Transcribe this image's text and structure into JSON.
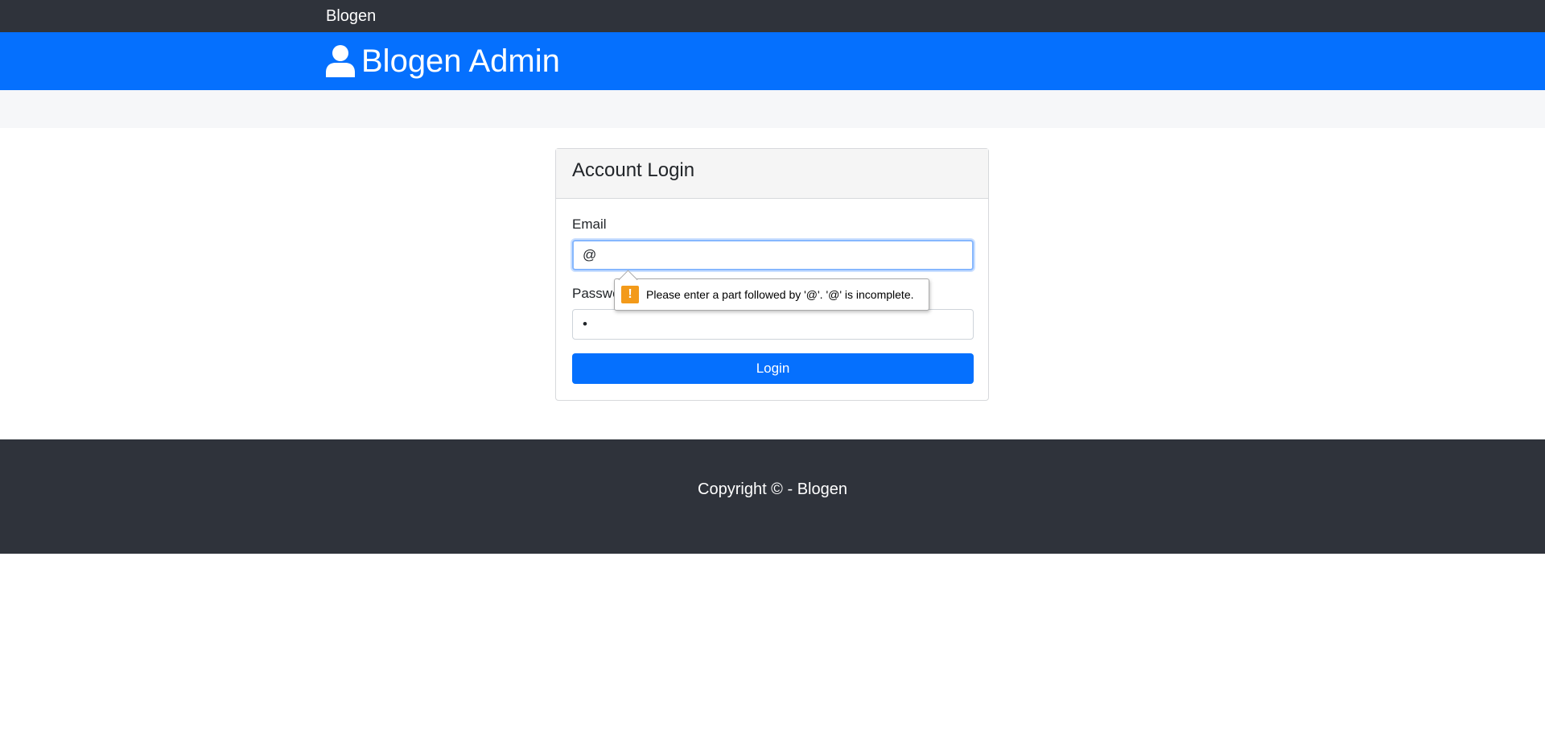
{
  "topnav": {
    "brand": "Blogen"
  },
  "header": {
    "title": "Blogen Admin",
    "icon": "user-icon"
  },
  "login_card": {
    "title": "Account Login",
    "email_label": "Email",
    "email_value": "@",
    "password_label": "Password",
    "password_value": "•",
    "login_button": "Login"
  },
  "validation_tooltip": {
    "icon": "warning-icon",
    "text": "Please enter a part followed by '@'. '@' is incomplete."
  },
  "footer": {
    "copyright": "Copyright © - Blogen"
  },
  "colors": {
    "dark": "#2f333b",
    "primary": "#0570fe",
    "light": "#f6f7f9",
    "warning": "#f39a1a"
  }
}
